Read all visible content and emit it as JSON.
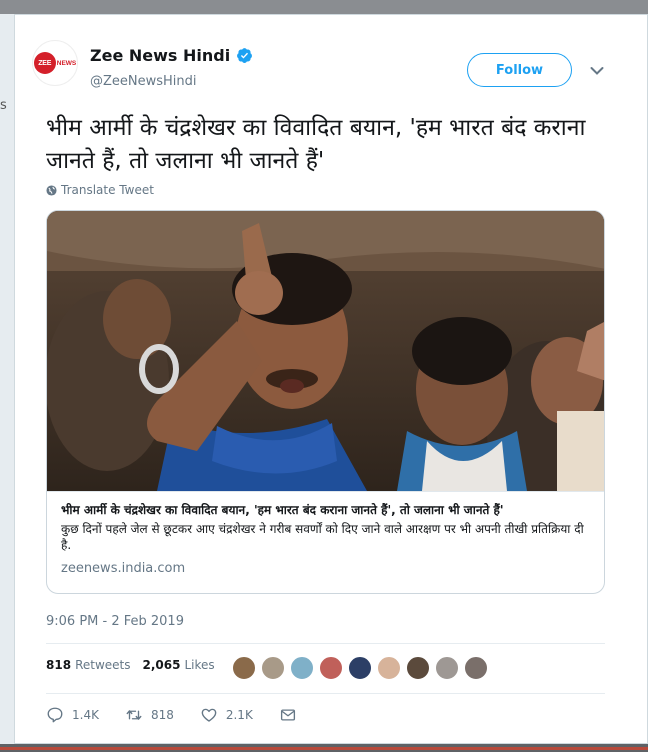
{
  "background": {
    "edge_fragment": "s"
  },
  "account": {
    "name": "Zee News Hindi",
    "handle": "@ZeeNewsHindi",
    "logo": {
      "zee": "ZEE",
      "news": "NEWS"
    },
    "verified_color": "#1da1f2"
  },
  "follow_label": "Follow",
  "tweet": {
    "text": "भीम आर्मी के चंद्रशेखर का विवादित बयान, 'हम भारत बंद कराना जानते हैं, तो जलाना भी जानते हैं'",
    "translate_label": "Translate Tweet"
  },
  "link_card": {
    "title": "भीम आर्मी के चंद्रशेखर का विवादित बयान, 'हम भारत बंद कराना जानते हैं', तो जलाना भी जानते हैं'",
    "description": "कुछ दिनों पहले जेल से छूटकर आए चंद्रशेखर ने गरीब सवर्णों को दिए जाने वाले आरक्षण पर भी अपनी तीखी प्रतिक्रिया दी है.",
    "domain": "zeenews.india.com"
  },
  "timestamp": "9:06 PM - 2 Feb 2019",
  "stats": {
    "retweets_count": "818",
    "retweets_label": "Retweets",
    "likes_count": "2,065",
    "likes_label": "Likes"
  },
  "likers": [
    "#8a6a4a",
    "#a89a88",
    "#7fb0c8",
    "#c0605a",
    "#2c3f66",
    "#d7b39a",
    "#5b4a3c",
    "#9e9894",
    "#7a6f6a"
  ],
  "actions": {
    "replies": "1.4K",
    "retweets": "818",
    "likes": "2.1K"
  },
  "accent": "#1da1f2"
}
